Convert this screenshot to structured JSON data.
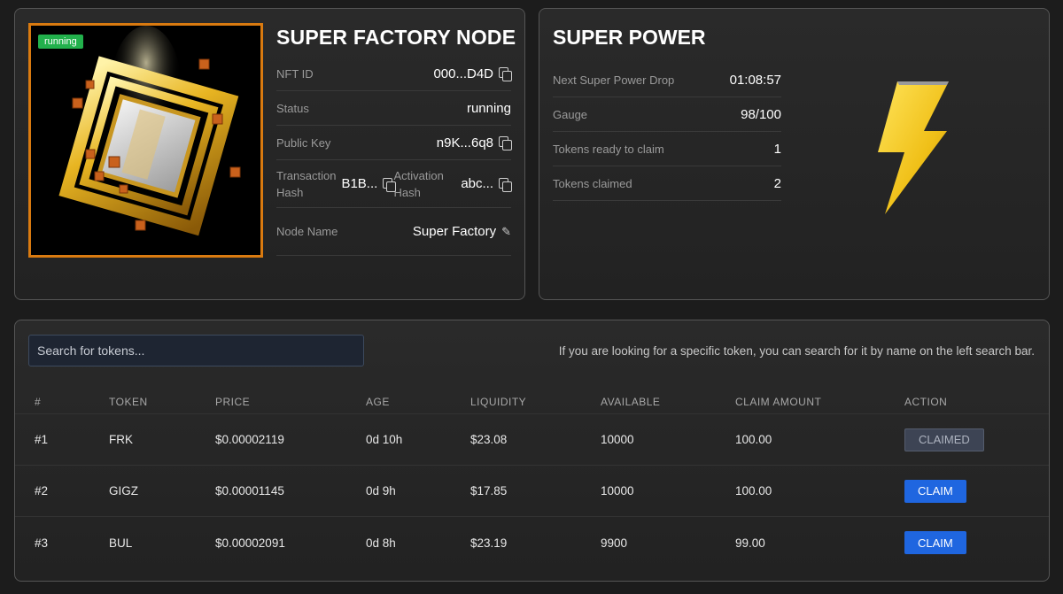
{
  "node": {
    "status_badge": "running",
    "title": "SUPER FACTORY NODE",
    "nft_id_label": "NFT ID",
    "nft_id": "000...D4D",
    "status_label": "Status",
    "status": "running",
    "public_key_label": "Public Key",
    "public_key": "n9K...6q8",
    "tx_hash_label": "Transaction Hash",
    "tx_hash": "B1B...",
    "activation_hash_label": "Activation Hash",
    "activation_hash": "abc...",
    "node_name_label": "Node Name",
    "node_name": "Super Factory",
    "accent_color": "#d97a10"
  },
  "power": {
    "title": "SUPER POWER",
    "rows": [
      {
        "label": "Next Super Power Drop",
        "value": "01:08:57"
      },
      {
        "label": "Gauge",
        "value": "98/100"
      },
      {
        "label": "Tokens ready to claim",
        "value": "1"
      },
      {
        "label": "Tokens claimed",
        "value": "2"
      }
    ],
    "icon": "lightning-bolt-icon",
    "icon_color": "#f2c81e"
  },
  "tokens": {
    "search_placeholder": "Search for tokens...",
    "search_help": "If you are looking for a specific token, you can search for it by name on the left search bar.",
    "columns": [
      "#",
      "TOKEN",
      "PRICE",
      "AGE",
      "LIQUIDITY",
      "AVAILABLE",
      "CLAIM AMOUNT",
      "ACTION"
    ],
    "rows": [
      {
        "rank": "#1",
        "token": "FRK",
        "price": "$0.00002119",
        "age": "0d 10h",
        "liquidity": "$23.08",
        "available": "10000",
        "claim_amount": "100.00",
        "action": "CLAIMED"
      },
      {
        "rank": "#2",
        "token": "GIGZ",
        "price": "$0.00001145",
        "age": "0d 9h",
        "liquidity": "$17.85",
        "available": "10000",
        "claim_amount": "100.00",
        "action": "CLAIM"
      },
      {
        "rank": "#3",
        "token": "BUL",
        "price": "$0.00002091",
        "age": "0d 8h",
        "liquidity": "$23.19",
        "available": "9900",
        "claim_amount": "99.00",
        "action": "CLAIM"
      }
    ],
    "claim_color": "#1f66e0",
    "claimed_color": "#3d4454"
  }
}
